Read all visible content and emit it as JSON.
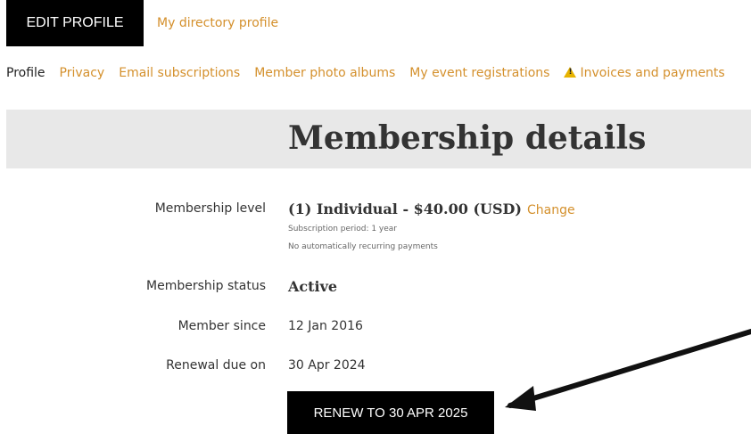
{
  "topbar": {
    "edit_profile_label": "EDIT PROFILE",
    "directory_profile_label": "My directory profile"
  },
  "tabs": [
    {
      "label": "Profile",
      "active": true
    },
    {
      "label": "Privacy"
    },
    {
      "label": "Email subscriptions"
    },
    {
      "label": "Member photo albums"
    },
    {
      "label": "My event registrations"
    },
    {
      "label": "Invoices and payments",
      "icon": "warning-icon"
    }
  ],
  "page": {
    "title": "Membership details"
  },
  "details": {
    "level_label": "Membership level",
    "level_value": "(1) Individual - $40.00 (USD)",
    "change_label": "Change",
    "subscription_period": "Subscription period: 1 year",
    "recurring_note": "No automatically recurring payments",
    "status_label": "Membership status",
    "status_value": "Active",
    "since_label": "Member since",
    "since_value": "12 Jan 2016",
    "renewal_label": "Renewal due on",
    "renewal_value": "30 Apr 2024"
  },
  "renew_button_label": "RENEW TO 30 APR 2025",
  "colors": {
    "link": "#d4902c",
    "button_bg": "#000000",
    "band_bg": "#e8e8e8"
  }
}
